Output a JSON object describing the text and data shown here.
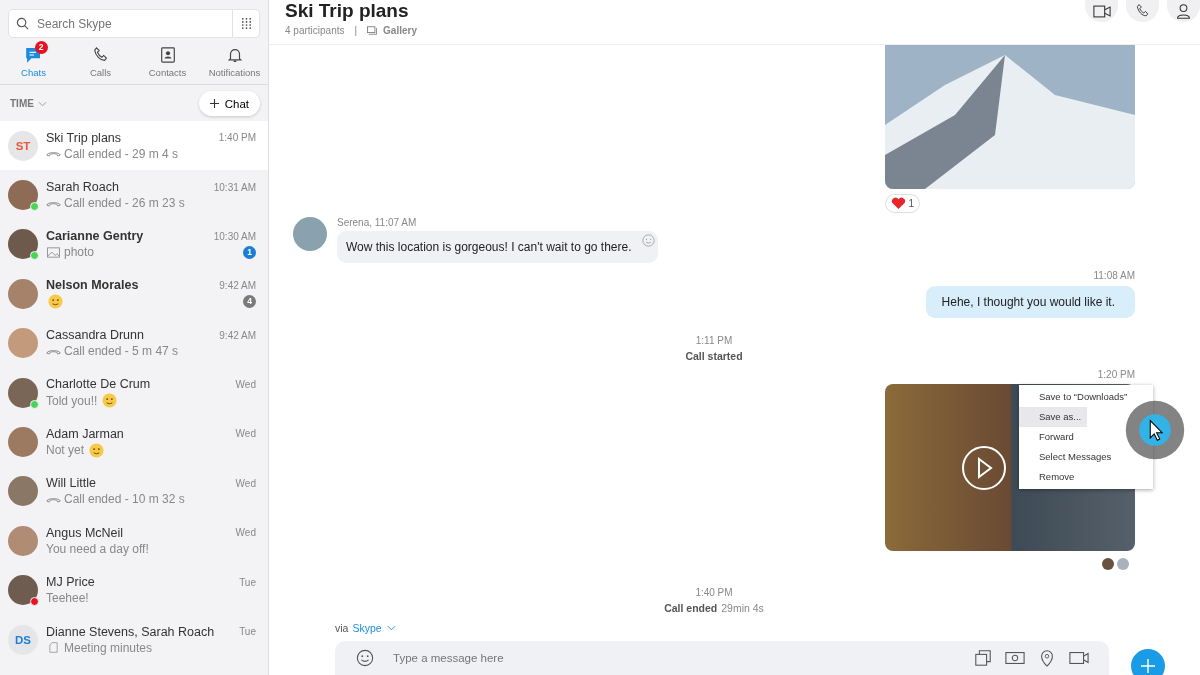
{
  "search": {
    "placeholder": "Search Skype"
  },
  "nav": [
    {
      "kind": "chats",
      "label": "Chats",
      "selected": true,
      "badge": "2"
    },
    {
      "kind": "calls",
      "label": "Calls",
      "selected": false
    },
    {
      "kind": "contacts",
      "label": "Contacts",
      "selected": false
    },
    {
      "kind": "notifications",
      "label": "Notifications",
      "selected": false
    }
  ],
  "sort": {
    "label": "TIME"
  },
  "new_chat": {
    "label": "Chat"
  },
  "chats": [
    {
      "name": "Ski Trip plans",
      "time": "1:40 PM",
      "preview": "Call ended - 29 m 4 s",
      "kind": "call",
      "initials": "ST",
      "color": "#e8573b",
      "selected": true,
      "bold": false,
      "online": false,
      "do_not_disturb": false
    },
    {
      "name": "Sarah Roach",
      "time": "10:31 AM",
      "preview": "Call ended - 26 m 23 s",
      "kind": "call",
      "selected": false,
      "bold": false,
      "online": true,
      "do_not_disturb": false
    },
    {
      "name": "Carianne Gentry",
      "time": "10:30 AM",
      "preview": "photo",
      "kind": "photo",
      "selected": false,
      "bold": true,
      "online": true,
      "do_not_disturb": false,
      "unread": "1",
      "muted": false
    },
    {
      "name": "Nelson Morales",
      "time": "9:42 AM",
      "kind": "emoji",
      "selected": false,
      "bold": true,
      "online": false,
      "do_not_disturb": false,
      "unread": "4",
      "muted": true
    },
    {
      "name": "Cassandra Drunn",
      "time": "9:42 AM",
      "preview": "Call ended - 5 m 47 s",
      "kind": "call",
      "selected": false,
      "bold": false,
      "online": false,
      "do_not_disturb": false
    },
    {
      "name": "Charlotte De Crum",
      "time": "Wed",
      "preview": "Told you!!",
      "kind": "emoji",
      "selected": false,
      "bold": false,
      "online": true,
      "do_not_disturb": false
    },
    {
      "name": "Adam Jarman",
      "time": "Wed",
      "preview": "Not yet",
      "kind": "emoji",
      "selected": false,
      "bold": false,
      "online": false,
      "do_not_disturb": false
    },
    {
      "name": "Will Little",
      "time": "Wed",
      "preview": "Call ended - 10 m 32 s",
      "kind": "call",
      "selected": false,
      "bold": false,
      "online": false,
      "do_not_disturb": false
    },
    {
      "name": "Angus McNeil",
      "time": "Wed",
      "preview": "You need a day off!",
      "kind": "text",
      "selected": false,
      "bold": false,
      "online": false,
      "do_not_disturb": false
    },
    {
      "name": "MJ Price",
      "time": "Tue",
      "preview": "Teehee!",
      "kind": "text",
      "selected": false,
      "bold": false,
      "online": false,
      "do_not_disturb": true
    },
    {
      "name": "Dianne Stevens, Sarah Roach",
      "time": "Tue",
      "preview": "Meeting minutes",
      "kind": "file",
      "initials": "DS",
      "color": "#1a7fd4",
      "selected": false,
      "bold": false,
      "online": false,
      "do_not_disturb": false
    }
  ],
  "conversation": {
    "title": "Ski Trip plans",
    "participants": "4 participants",
    "separator": "|",
    "gallery": "Gallery"
  },
  "messages": [
    {
      "kind": "photo",
      "reaction_count": "1"
    },
    {
      "kind": "incoming",
      "sender": "Serena, 11:07 AM",
      "text": "Wow this location is gorgeous! I can't wait to go there."
    },
    {
      "kind": "outgoing",
      "time": "11:08 AM",
      "text": "Hehe, I thought you would like it."
    },
    {
      "kind": "event",
      "time": "1:11 PM",
      "title": "Call started"
    },
    {
      "kind": "video",
      "time": "1:20 PM",
      "menu": [
        {
          "label": "Save to “Downloads”",
          "selected": false
        },
        {
          "label": "Save as...",
          "selected": true
        },
        {
          "label": "Forward",
          "selected": false
        },
        {
          "label": "Select Messages",
          "selected": false
        },
        {
          "label": "Remove",
          "selected": false
        }
      ]
    },
    {
      "kind": "event",
      "time": "1:40 PM",
      "title": "Call ended",
      "detail": "29min 4s"
    }
  ],
  "via": {
    "label": "via",
    "service": "Skype"
  },
  "composer": {
    "placeholder": "Type a message here"
  }
}
